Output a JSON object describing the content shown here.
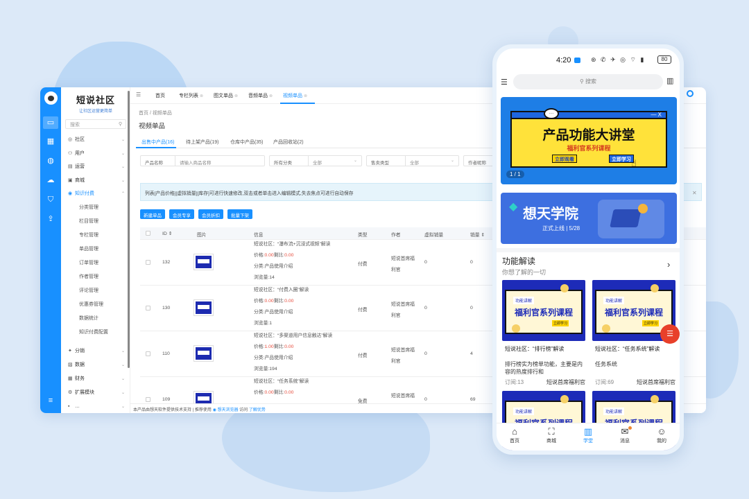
{
  "admin": {
    "logo_title": "短说社区",
    "logo_sub": "让社区运营更简单",
    "search_placeholder": "搜索",
    "menu": [
      {
        "label": "社区",
        "icon": "community-icon",
        "expand": "⌄"
      },
      {
        "label": "用户",
        "icon": "user-icon",
        "expand": "⌄"
      },
      {
        "label": "运营",
        "icon": "operation-icon",
        "expand": "⌄"
      },
      {
        "label": "商城",
        "icon": "mall-icon",
        "expand": "⌄"
      },
      {
        "label": "知识付费",
        "icon": "knowledge-icon",
        "expand": "⌃"
      }
    ],
    "submenu": [
      "分类管理",
      "栏目管理",
      "专栏管理",
      "单品管理",
      "订单管理",
      "作者管理",
      "评论管理",
      "优惠券管理",
      "数据统计",
      "知识付费配置"
    ],
    "menu_bottom": [
      {
        "label": "分销",
        "icon": "distribution-icon",
        "expand": "⌄"
      },
      {
        "label": "数据",
        "icon": "data-icon",
        "expand": "⌄"
      },
      {
        "label": "财务",
        "icon": "finance-icon",
        "expand": "⌄"
      },
      {
        "label": "扩展模块",
        "icon": "extension-icon",
        "expand": "⌄"
      },
      {
        "label": "…",
        "icon": "more-icon",
        "expand": "⌄"
      }
    ],
    "top_tabs": [
      {
        "label": "首页",
        "closable": false
      },
      {
        "label": "专栏列表",
        "closable": true
      },
      {
        "label": "图文单品",
        "closable": true
      },
      {
        "label": "音频单品",
        "closable": true
      },
      {
        "label": "视频单品",
        "closable": true
      }
    ],
    "breadcrumb": [
      "首页",
      "视频单品"
    ],
    "page_title": "视频单品",
    "status_tabs": [
      "出售中产品(16)",
      "待上架产品(19)",
      "仓库中产品(35)",
      "产品回收站(2)"
    ],
    "filters": {
      "name_label": "产品名称",
      "name_placeholder": "请输入商品名称",
      "cat_label": "所有分类",
      "cat_value": "全部",
      "sale_label": "售卖类型",
      "sale_value": "全部",
      "author_label": "作者昵称"
    },
    "notice": "列表[产品价格][虚拟销量][库存]可进行快速修改,双击或者单击进入编辑模式,失去焦点可进行自动保存",
    "buttons": [
      "新建单品",
      "会员专享",
      "会员折扣",
      "批量下架"
    ],
    "table_headers": [
      "ID",
      "图片",
      "信息",
      "类型",
      "作者",
      "虚拟销量",
      "销量"
    ],
    "rows": [
      {
        "id": "132",
        "title": "短说社区：“瀑布流+沉浸式视频”解读",
        "price_prefix": "价格:",
        "price": "0.00",
        "price_mid": "剩比:",
        "discount": "0.00",
        "category": "分类:产品使用介绍",
        "views": "浏览量:14",
        "type": "付费",
        "author1": "短说首席福",
        "author2": "利官",
        "virtual": "0",
        "sales": "0"
      },
      {
        "id": "130",
        "title": "短说社区：“付费入圈”解读",
        "price_prefix": "价格:",
        "price": "0.00",
        "price_mid": "剩比:",
        "discount": "0.00",
        "category": "分类:产品使用介绍",
        "views": "浏览量:1",
        "type": "付费",
        "author1": "短说首席福",
        "author2": "利官",
        "virtual": "0",
        "sales": "0"
      },
      {
        "id": "110",
        "title": "短说社区：“多渠道用户信息触达”解读",
        "price_prefix": "价格:",
        "price": "1.00",
        "price_mid": "剩比:",
        "discount": "0.00",
        "category": "分类:产品使用介绍",
        "views": "浏览量:194",
        "type": "付费",
        "author1": "短说首席福",
        "author2": "利官",
        "virtual": "0",
        "sales": "4"
      },
      {
        "id": "109",
        "title": "短说社区：“任务系统”解读",
        "price_prefix": "价格:",
        "price": "0.00",
        "price_mid": "剩比:",
        "discount": "0.00",
        "category": "",
        "views": "",
        "type": "免费",
        "author1": "短说首席福",
        "author2": "",
        "virtual": "0",
        "sales": "69"
      }
    ],
    "footer": {
      "text": "本产品由想天软件提供技术支持",
      "sep": "|",
      "recommend": "推荐使用",
      "browser": "想天浏览器",
      "access": "访问",
      "learn": "了解优势"
    }
  },
  "phone": {
    "time": "4:20",
    "status_icons": "⊛ ✆ ✈ ◎ ⌔ ▮",
    "battery": "80",
    "search_placeholder": "搜索",
    "banner1": {
      "title": "产品功能大讲堂",
      "subtitle": "福利官系列课程",
      "btn1": "立即观看",
      "btn2": "立即学习",
      "page": "1 / 1"
    },
    "banner2": {
      "title": "想天学院",
      "subtitle": "正式上线 | 5/28"
    },
    "section_title": "功能解读",
    "section_sub": "你想了解的一切",
    "cards": [
      {
        "tag": "功能讲解",
        "img_title": "福利官系列课程",
        "img_btn": "立即学习",
        "title": "短说社区：“排行榜”解读",
        "desc": "排行榜实为榜单功能，主要是内容的热度排行和",
        "subs": "订阅:13",
        "author": "短说首席福利官"
      },
      {
        "tag": "功能讲解",
        "img_title": "福利官系列课程",
        "img_btn": "立即学习",
        "title": "短说社区：“任务系统”解读",
        "desc": "任务系统",
        "subs": "订阅:69",
        "author": "短说首席福利官"
      },
      {
        "tag": "功能讲解",
        "img_title": "福利官系列课程",
        "img_btn": "",
        "title": "",
        "desc": "",
        "subs": "",
        "author": ""
      },
      {
        "tag": "功能讲解",
        "img_title": "福利官系列课程",
        "img_btn": "",
        "title": "",
        "desc": "",
        "subs": "",
        "author": ""
      }
    ],
    "tabbar": [
      {
        "label": "首页",
        "icon": "home-icon"
      },
      {
        "label": "商城",
        "icon": "shop-bag-icon"
      },
      {
        "label": "学堂",
        "icon": "book-icon",
        "active": true
      },
      {
        "label": "消息",
        "icon": "mail-icon",
        "badge": true
      },
      {
        "label": "我的",
        "icon": "profile-icon"
      }
    ]
  }
}
